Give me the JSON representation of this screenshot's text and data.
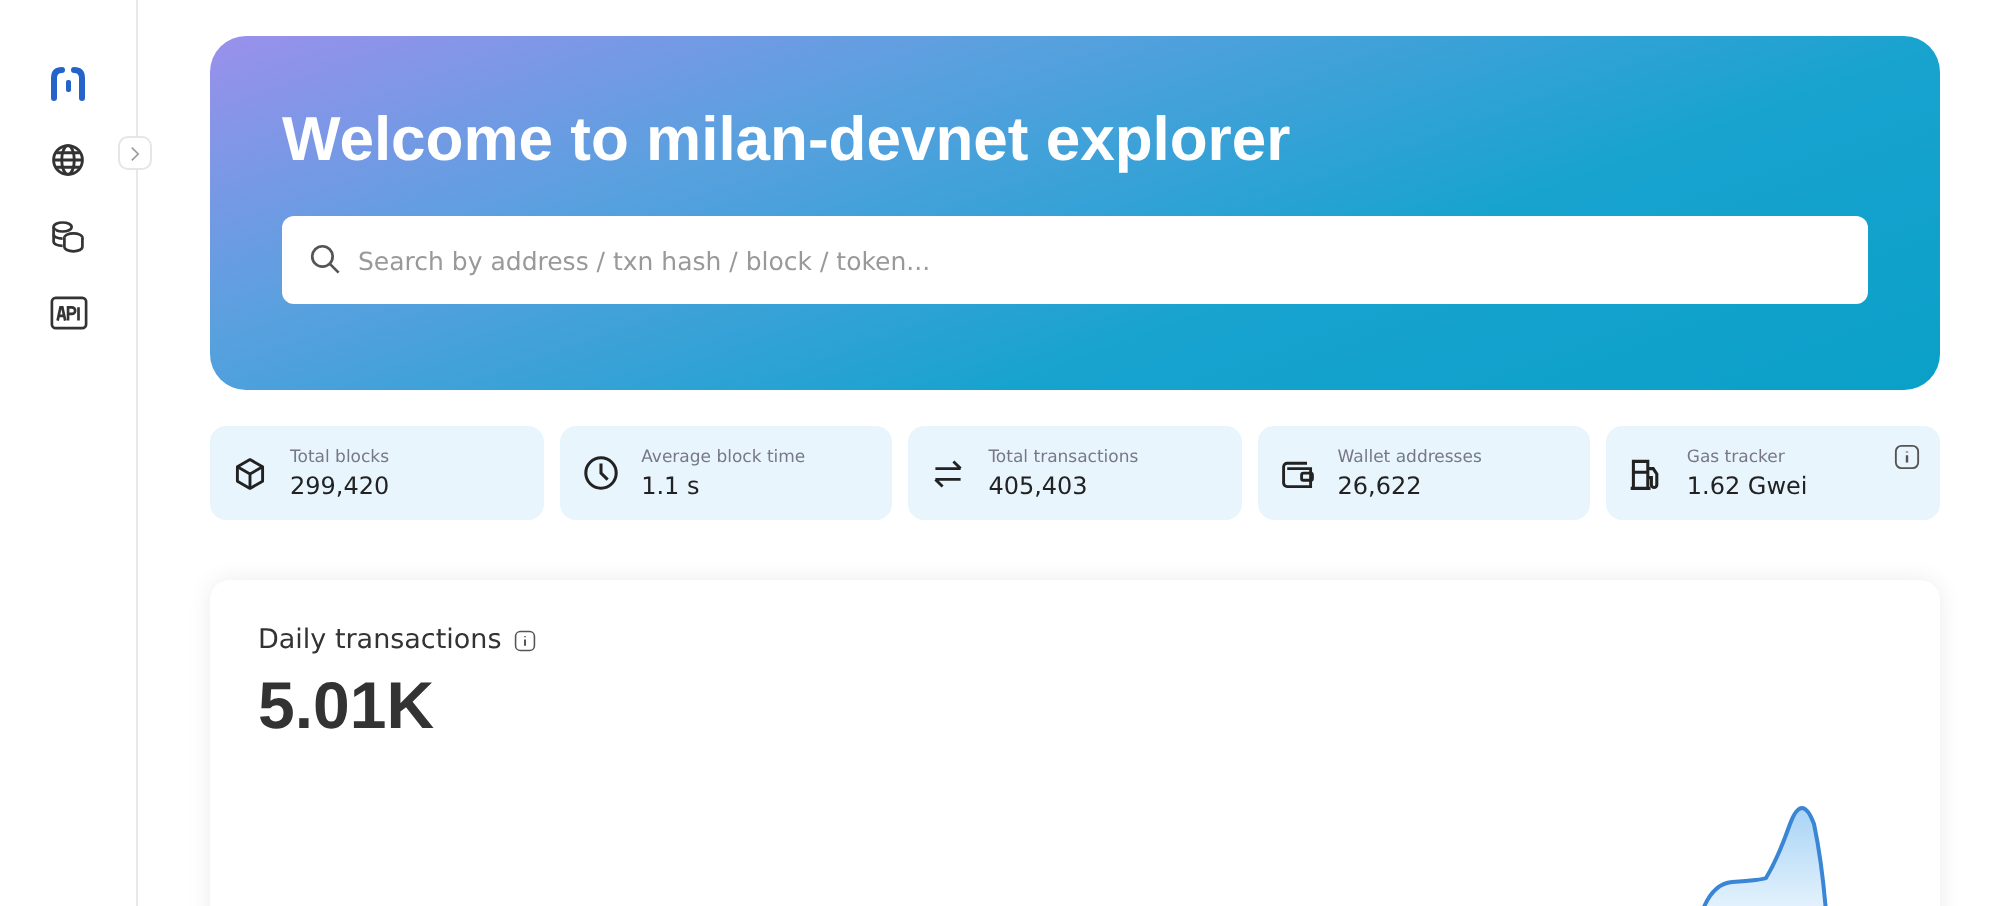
{
  "hero": {
    "title": "Welcome to milan-devnet explorer",
    "search": {
      "placeholder": "Search by address / txn hash / block / token..."
    }
  },
  "stats": [
    {
      "kind": "blocks",
      "label": "Total blocks",
      "value": "299,420",
      "info": false
    },
    {
      "kind": "time",
      "label": "Average block time",
      "value": "1.1 s",
      "info": false
    },
    {
      "kind": "transactions",
      "label": "Total transactions",
      "value": "405,403",
      "info": false
    },
    {
      "kind": "wallet",
      "label": "Wallet addresses",
      "value": "26,622",
      "info": false
    },
    {
      "kind": "gas",
      "label": "Gas tracker",
      "value": "1.62 Gwei",
      "info": true
    }
  ],
  "daily": {
    "title": "Daily transactions",
    "value": "5.01K"
  }
}
